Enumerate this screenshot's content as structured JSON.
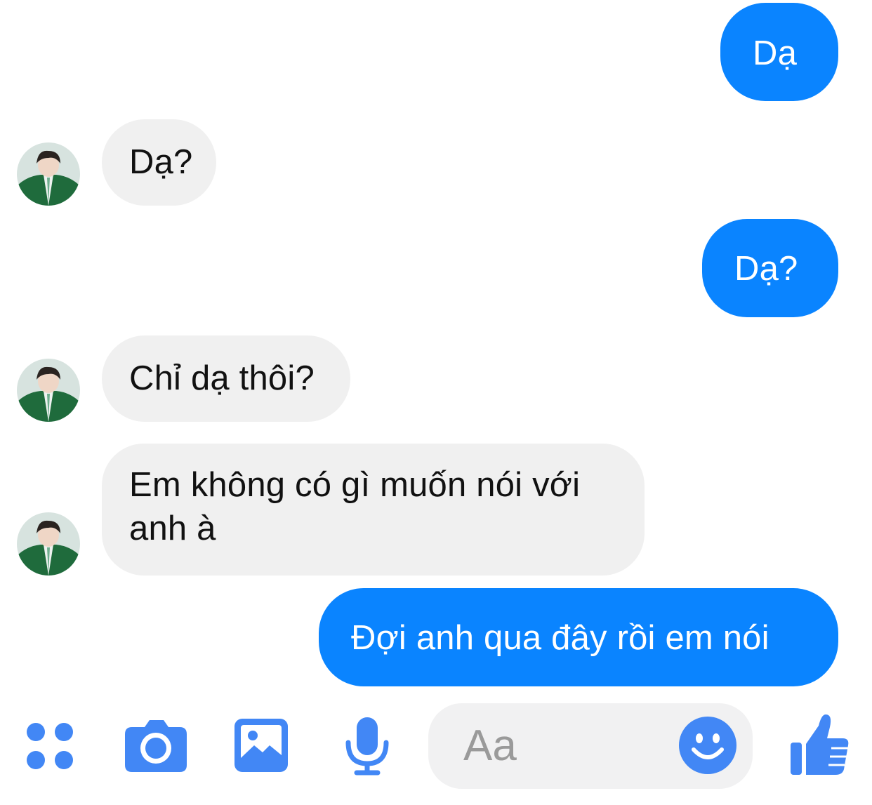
{
  "messages": [
    {
      "side": "out",
      "text": "Dạ"
    },
    {
      "side": "in",
      "text": "Dạ?"
    },
    {
      "side": "out",
      "text": "Dạ?"
    },
    {
      "side": "in",
      "text": "Chỉ dạ thôi?"
    },
    {
      "side": "in",
      "text_lines": [
        "Em không có gì muốn nói với",
        "anh à"
      ]
    },
    {
      "side": "out",
      "text": "Đợi anh qua đây rồi em nói"
    }
  ],
  "composer": {
    "placeholder": "Aa"
  },
  "toolbar": {
    "icons": [
      "apps-icon",
      "camera-icon",
      "image-icon",
      "microphone-icon",
      "emoji-icon",
      "thumbs-up-icon"
    ]
  },
  "colors": {
    "outgoing_bubble": "#0a84ff",
    "incoming_bubble": "#f0f0f0",
    "icon_blue": "#4287f5"
  }
}
